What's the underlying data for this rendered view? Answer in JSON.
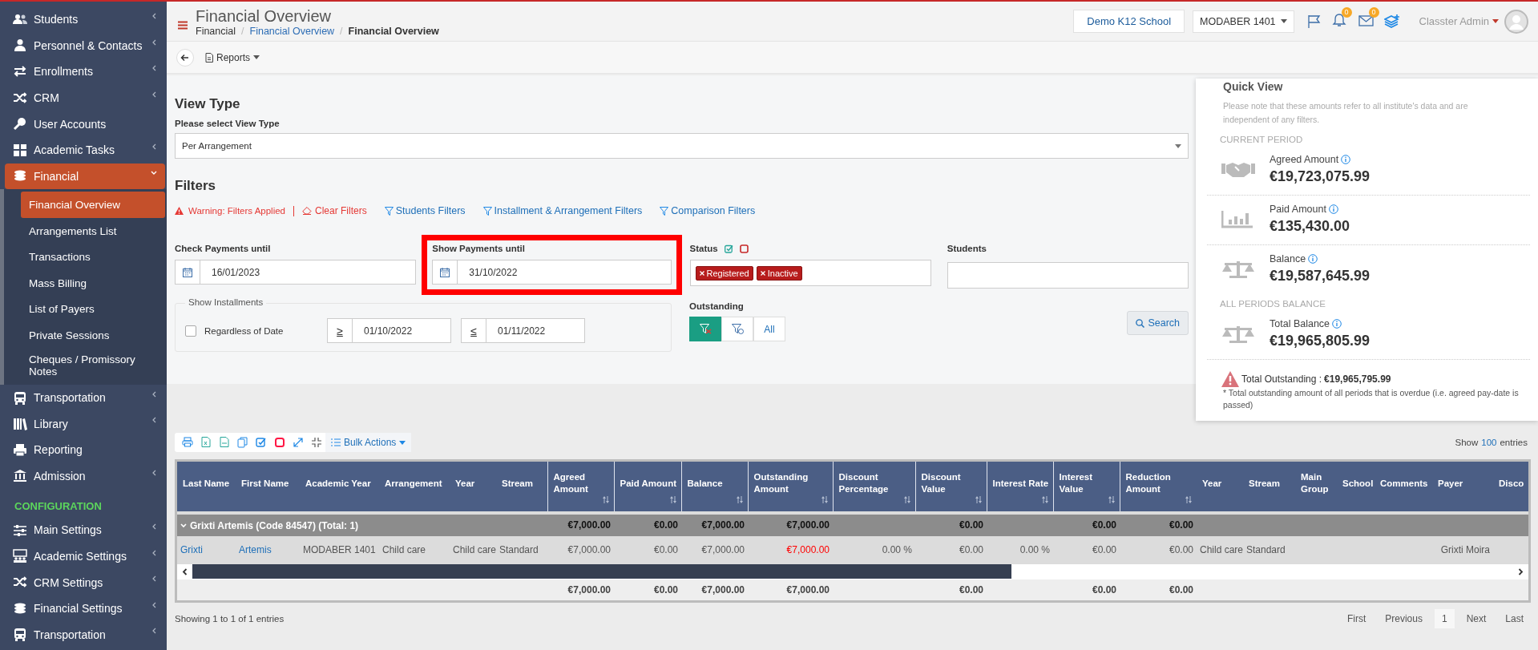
{
  "sidebar": {
    "items": [
      {
        "kind": "link",
        "label": "Students",
        "expanded": false,
        "selected": false
      },
      {
        "kind": "link",
        "label": "Personnel & Contacts",
        "expanded": false,
        "selected": false
      },
      {
        "kind": "link",
        "label": "Enrollments",
        "expanded": false,
        "selected": false
      },
      {
        "kind": "link",
        "label": "CRM",
        "expanded": false,
        "selected": false
      },
      {
        "kind": "link",
        "label": "User Accounts",
        "selected": false
      },
      {
        "kind": "link",
        "label": "Academic Tasks",
        "expanded": false,
        "selected": false
      },
      {
        "kind": "link",
        "label": "Financial",
        "expanded": true,
        "selected": true,
        "children": [
          {
            "label": "Financial Overview",
            "selected": true
          },
          {
            "label": "Arrangements List",
            "selected": false
          },
          {
            "label": "Transactions",
            "selected": false
          },
          {
            "label": "Mass Billing",
            "selected": false
          },
          {
            "label": "List of Payers",
            "selected": false
          },
          {
            "label": "Private Sessions",
            "selected": false
          },
          {
            "label": "Cheques / Promissory Notes",
            "selected": false
          }
        ]
      },
      {
        "kind": "link",
        "label": "Transportation",
        "expanded": false,
        "selected": false
      },
      {
        "kind": "link",
        "label": "Library",
        "expanded": false,
        "selected": false
      },
      {
        "kind": "link",
        "label": "Reporting",
        "selected": false
      },
      {
        "kind": "link",
        "label": "Admission",
        "expanded": false,
        "selected": false
      },
      {
        "kind": "heading",
        "label": "CONFIGURATION"
      },
      {
        "kind": "link",
        "label": "Main Settings",
        "expanded": false,
        "selected": false
      },
      {
        "kind": "link",
        "label": "Academic Settings",
        "expanded": false,
        "selected": false
      },
      {
        "kind": "link",
        "label": "CRM Settings",
        "expanded": false,
        "selected": false
      },
      {
        "kind": "link",
        "label": "Financial Settings",
        "expanded": false,
        "selected": false
      },
      {
        "kind": "link",
        "label": "Transportation",
        "expanded": false,
        "selected": false
      }
    ]
  },
  "header": {
    "title": "Financial Overview",
    "breadcrumb": [
      {
        "label": "Financial",
        "kind": "text"
      },
      {
        "kind": "separator",
        "label": "/"
      },
      {
        "label": "Financial Overview",
        "kind": "link"
      },
      {
        "kind": "separator",
        "label": "/"
      },
      {
        "label": "Financial Overview",
        "kind": "current"
      }
    ],
    "school": "Demo K12 School",
    "year": "MODABER 1401",
    "notifications": "0",
    "messages": "0",
    "user": "Classter Admin"
  },
  "toolbar": {
    "reports": "Reports"
  },
  "view_type": {
    "heading": "View Type",
    "label": "Please select View Type",
    "value": "Per Arrangement"
  },
  "filters": {
    "heading": "Filters",
    "warning": "Warning: Filters Applied",
    "clear": "Clear Filters",
    "links": [
      "Students Filters",
      "Installment & Arrangement Filters",
      "Comparison Filters"
    ],
    "check_payments": {
      "label": "Check Payments until",
      "value": "16/01/2023"
    },
    "show_payments": {
      "label": "Show Payments until",
      "value": "31/10/2022",
      "highlighted": true
    },
    "status": {
      "label": "Status",
      "tags": [
        "Registered",
        "Inactive"
      ]
    },
    "students": {
      "label": "Students"
    },
    "installments": {
      "legend": "Show Installments",
      "checkbox": "Regardless of Date",
      "checked": false,
      "from_op": "≥",
      "from": "01/10/2022",
      "to_op": "≤",
      "to": "01/11/2022"
    },
    "outstanding": {
      "label": "Outstanding",
      "options": [
        {
          "kind": "overdue",
          "selected": true
        },
        {
          "kind": "paid",
          "selected": false
        },
        {
          "kind": "text",
          "label": "All",
          "selected": false
        }
      ]
    },
    "search": "Search"
  },
  "quick_view": {
    "title": "Quick View",
    "note": "Please note that these amounts refer to all institute's data and are independent of any filters.",
    "groups": [
      {
        "heading": "CURRENT PERIOD",
        "items": [
          {
            "kind": "agreed",
            "label": "Agreed Amount",
            "amount": "€19,723,075.99"
          },
          {
            "kind": "paid",
            "label": "Paid Amount",
            "amount": "€135,430.00"
          },
          {
            "kind": "balance",
            "label": "Balance",
            "amount": "€19,587,645.99"
          }
        ]
      },
      {
        "heading": "ALL PERIODS BALANCE",
        "items": [
          {
            "kind": "balance",
            "label": "Total Balance",
            "amount": "€19,965,805.99"
          }
        ]
      }
    ],
    "outstanding_label": "Total Outstanding :",
    "outstanding_value": "€19,965,795.99",
    "footnote": "* Total outstanding amount of all periods that is overdue (i.e. agreed pay-date is passed)"
  },
  "table": {
    "bulk_actions": "Bulk Actions",
    "show": "Show",
    "page_size": "100",
    "entries": "entries",
    "columns": [
      {
        "label": "Last Name",
        "sortable": false
      },
      {
        "label": "First Name",
        "sortable": false
      },
      {
        "label": "Academic Year",
        "sortable": false
      },
      {
        "label": "Arrangement",
        "sortable": false
      },
      {
        "label": "Year",
        "sortable": false
      },
      {
        "label": "Stream",
        "sortable": false
      },
      {
        "label": "Agreed Amount",
        "sortable": true
      },
      {
        "label": "Paid Amount",
        "sortable": true
      },
      {
        "label": "Balance",
        "sortable": true
      },
      {
        "label": "Outstanding Amount",
        "sortable": true
      },
      {
        "label": "Discount Percentage",
        "sortable": true
      },
      {
        "label": "Discount Value",
        "sortable": true
      },
      {
        "label": "Interest Rate",
        "sortable": true
      },
      {
        "label": "Interest Value",
        "sortable": true
      },
      {
        "label": "Reduction Amount",
        "sortable": true
      },
      {
        "label": "Year",
        "sortable": false
      },
      {
        "label": "Stream",
        "sortable": false
      },
      {
        "label": "Main Group",
        "sortable": false
      },
      {
        "label": "School",
        "sortable": false
      },
      {
        "label": "Comments",
        "sortable": false
      },
      {
        "label": "Payer",
        "sortable": false
      },
      {
        "label": "Disco",
        "sortable": false
      }
    ],
    "group": {
      "label": "Grixti Artemis (Code 84547) (Total: 1)",
      "expanded": true,
      "totals": [
        {
          "kind": "amount",
          "text": "€7,000.00"
        },
        {
          "kind": "amount",
          "text": "€0.00"
        },
        {
          "kind": "amount",
          "text": "€7,000.00"
        },
        {
          "kind": "amount",
          "text": "€7,000.00"
        },
        {
          "kind": "blank"
        },
        {
          "kind": "amount",
          "text": "€0.00"
        },
        {
          "kind": "blank"
        },
        {
          "kind": "amount",
          "text": "€0.00"
        },
        {
          "kind": "amount",
          "text": "€0.00"
        },
        {
          "kind": "blank"
        },
        {
          "kind": "blank"
        },
        {
          "kind": "blank"
        },
        {
          "kind": "blank"
        },
        {
          "kind": "blank"
        },
        {
          "kind": "blank"
        },
        {
          "kind": "blank"
        }
      ]
    },
    "rows": [
      {
        "cells": [
          {
            "text": "Grixti",
            "kind": "link"
          },
          {
            "text": "Artemis",
            "kind": "link"
          },
          {
            "text": "MODABER 1401",
            "kind": "text"
          },
          {
            "text": "Child care",
            "kind": "text"
          },
          {
            "text": "Child care",
            "kind": "text"
          },
          {
            "text": "Standard",
            "kind": "text"
          },
          {
            "text": "€7,000.00",
            "kind": "amount"
          },
          {
            "text": "€0.00",
            "kind": "amount"
          },
          {
            "text": "€7,000.00",
            "kind": "amount"
          },
          {
            "text": "€7,000.00",
            "kind": "overdue"
          },
          {
            "text": "0.00 %",
            "kind": "amount"
          },
          {
            "text": "€0.00",
            "kind": "amount"
          },
          {
            "text": "0.00 %",
            "kind": "amount"
          },
          {
            "text": "€0.00",
            "kind": "amount"
          },
          {
            "text": "€0.00",
            "kind": "amount"
          },
          {
            "text": "Child care",
            "kind": "text"
          },
          {
            "text": "Standard",
            "kind": "text"
          },
          {
            "kind": "blank"
          },
          {
            "kind": "blank"
          },
          {
            "kind": "blank"
          },
          {
            "text": "Grixti Moira",
            "kind": "amount"
          },
          {
            "kind": "blank"
          }
        ]
      }
    ],
    "footer": [
      {
        "kind": "blank"
      },
      {
        "kind": "blank"
      },
      {
        "kind": "blank"
      },
      {
        "kind": "blank"
      },
      {
        "kind": "blank"
      },
      {
        "kind": "blank"
      },
      {
        "kind": "amount",
        "text": "€7,000.00"
      },
      {
        "kind": "amount",
        "text": "€0.00"
      },
      {
        "kind": "amount",
        "text": "€7,000.00"
      },
      {
        "kind": "amount",
        "text": "€7,000.00"
      },
      {
        "kind": "blank"
      },
      {
        "kind": "amount",
        "text": "€0.00"
      },
      {
        "kind": "blank"
      },
      {
        "kind": "amount",
        "text": "€0.00"
      },
      {
        "kind": "amount",
        "text": "€0.00"
      },
      {
        "kind": "blank"
      },
      {
        "kind": "blank"
      },
      {
        "kind": "blank"
      },
      {
        "kind": "blank"
      },
      {
        "kind": "blank"
      },
      {
        "kind": "blank"
      },
      {
        "kind": "blank"
      }
    ],
    "info": "Showing 1 to 1 of 1 entries",
    "pagination": [
      {
        "label": "First",
        "selected": false
      },
      {
        "label": "Previous",
        "selected": false
      },
      {
        "label": "1",
        "selected": true
      },
      {
        "label": "Next",
        "selected": false
      },
      {
        "label": "Last",
        "selected": false
      }
    ]
  }
}
